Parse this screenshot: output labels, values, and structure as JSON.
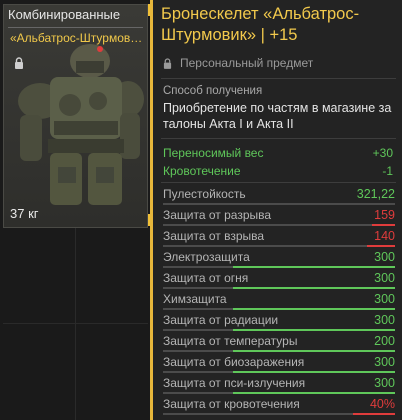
{
  "card": {
    "category": "Комбинированные",
    "item_name": "«Альбатрос-Штурмови…",
    "weight": "37 кг",
    "locked": true
  },
  "tooltip": {
    "title": "Бронескелет «Альбатрос-Штурмовик» | +15",
    "personal_label": "Персональный предмет",
    "acquire_label": "Способ получения",
    "acquire_text": "Приобретение по частям в магазине за талоны Акта I и Акта II",
    "modifiers": [
      {
        "name": "Переносимый вес",
        "value": "+30"
      },
      {
        "name": "Кровотечение",
        "value": "-1"
      }
    ],
    "stats": [
      {
        "name": "Пулестойкость",
        "value": "321,22",
        "color": "#5fc75a",
        "fill": 0.0
      },
      {
        "name": "Защита от разрыва",
        "value": "159",
        "color": "#e03c3c",
        "fill": 0.1
      },
      {
        "name": "Защита от взрыва",
        "value": "140",
        "color": "#e03c3c",
        "fill": 0.12
      },
      {
        "name": "Электрозащита",
        "value": "300",
        "color": "#5fc75a",
        "fill": 0.7
      },
      {
        "name": "Защита от огня",
        "value": "300",
        "color": "#5fc75a",
        "fill": 0.7
      },
      {
        "name": "Химзащита",
        "value": "300",
        "color": "#5fc75a",
        "fill": 0.7
      },
      {
        "name": "Защита от радиации",
        "value": "300",
        "color": "#5fc75a",
        "fill": 0.7
      },
      {
        "name": "Защита от температуры",
        "value": "200",
        "color": "#5fc75a",
        "fill": 0.7
      },
      {
        "name": "Защита от биозаражения",
        "value": "300",
        "color": "#5fc75a",
        "fill": 0.7
      },
      {
        "name": "Защита от пси-излучения",
        "value": "300",
        "color": "#5fc75a",
        "fill": 0.7
      },
      {
        "name": "Защита от кровотечения",
        "value": "40%",
        "color": "#e03c3c",
        "fill": 0.18
      }
    ]
  },
  "icons": [
    "lock-icon",
    "armor-item-icon"
  ],
  "colors": {
    "accent": "#f2c94c",
    "positive": "#5fc75a",
    "negative": "#e03c3c"
  }
}
